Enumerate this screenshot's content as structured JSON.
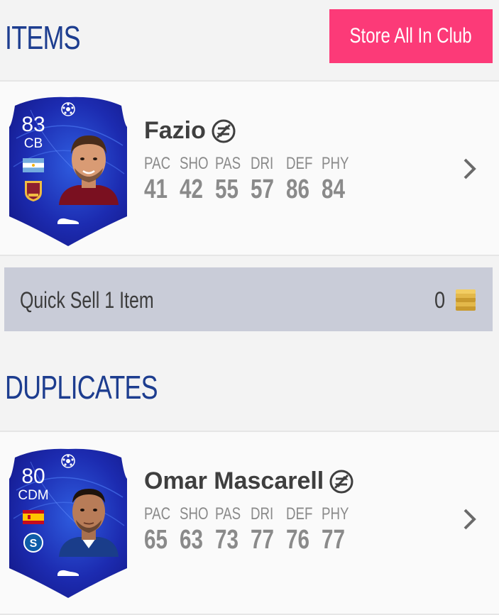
{
  "header": {
    "title": "ITEMS",
    "store_all_label": "Store All In Club"
  },
  "items": [
    {
      "name": "Fazio",
      "rating": "83",
      "position": "CB",
      "nation_flag": "argentina-flag-icon",
      "club_badge": "as-roma-badge-icon",
      "untradeable_icon": "untradeable-icon",
      "stats": [
        {
          "label": "PAC",
          "value": "41"
        },
        {
          "label": "SHO",
          "value": "42"
        },
        {
          "label": "PAS",
          "value": "55"
        },
        {
          "label": "DRI",
          "value": "57"
        },
        {
          "label": "DEF",
          "value": "86"
        },
        {
          "label": "PHY",
          "value": "84"
        }
      ]
    }
  ],
  "quick_sell": {
    "label": "Quick Sell 1 Item",
    "value": "0",
    "icon": "coins-icon"
  },
  "duplicates": {
    "title": "DUPLICATES",
    "items": [
      {
        "name": "Omar Mascarell",
        "rating": "80",
        "position": "CDM",
        "nation_flag": "spain-flag-icon",
        "club_badge": "schalke-04-badge-icon",
        "untradeable_icon": "untradeable-icon",
        "stats": [
          {
            "label": "PAC",
            "value": "65"
          },
          {
            "label": "SHO",
            "value": "63"
          },
          {
            "label": "PAS",
            "value": "73"
          },
          {
            "label": "DRI",
            "value": "77"
          },
          {
            "label": "DEF",
            "value": "76"
          },
          {
            "label": "PHY",
            "value": "77"
          }
        ]
      }
    ]
  },
  "colors": {
    "accent_pink": "#fc3a78",
    "header_blue": "#1d3d8f",
    "card_blue": "#1c2bb0",
    "quick_sell_bg": "#c9ccd8"
  }
}
